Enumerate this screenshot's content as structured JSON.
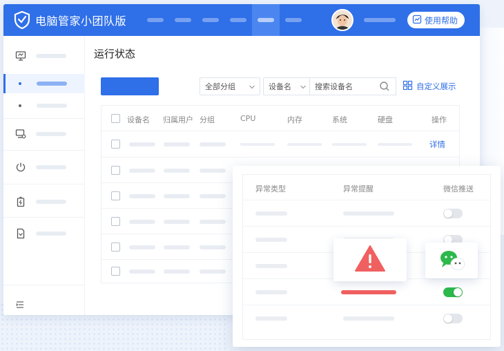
{
  "header": {
    "app_title": "电脑管家小团队版",
    "help_label": "使用帮助"
  },
  "main": {
    "page_title": "运行状态",
    "filters": {
      "group_select": "全部分组",
      "field_select": "设备名",
      "search_placeholder": "搜索设备名",
      "custom_view_label": "自定义展示"
    },
    "table": {
      "columns": [
        "设备名",
        "归属用户",
        "分组",
        "CPU",
        "内存",
        "系统",
        "硬盘",
        "操作"
      ],
      "row_action_label": "详情",
      "row_count": 6
    }
  },
  "popup": {
    "columns": [
      "异常类型",
      "异常提醒",
      "微信推送"
    ],
    "toggles": [
      false,
      false,
      false,
      true,
      false
    ]
  },
  "colors": {
    "brand": "#2f6fe8",
    "cpu_meter": "#f5a623",
    "mem_meter": "#1fbf9a",
    "sys_meter": "#1fbf9a",
    "disk_meter": "#f5a623",
    "warning": "#f06060",
    "wechat": "#2db84c"
  },
  "icons": [
    "shield-logo-icon",
    "monitor-icon",
    "device-settings-icon",
    "power-icon",
    "battery-icon",
    "document-icon",
    "menu-collapse-icon",
    "search-icon",
    "grid-icon",
    "help-icon",
    "warning-triangle-icon",
    "wechat-icon",
    "chevron-down-icon"
  ]
}
